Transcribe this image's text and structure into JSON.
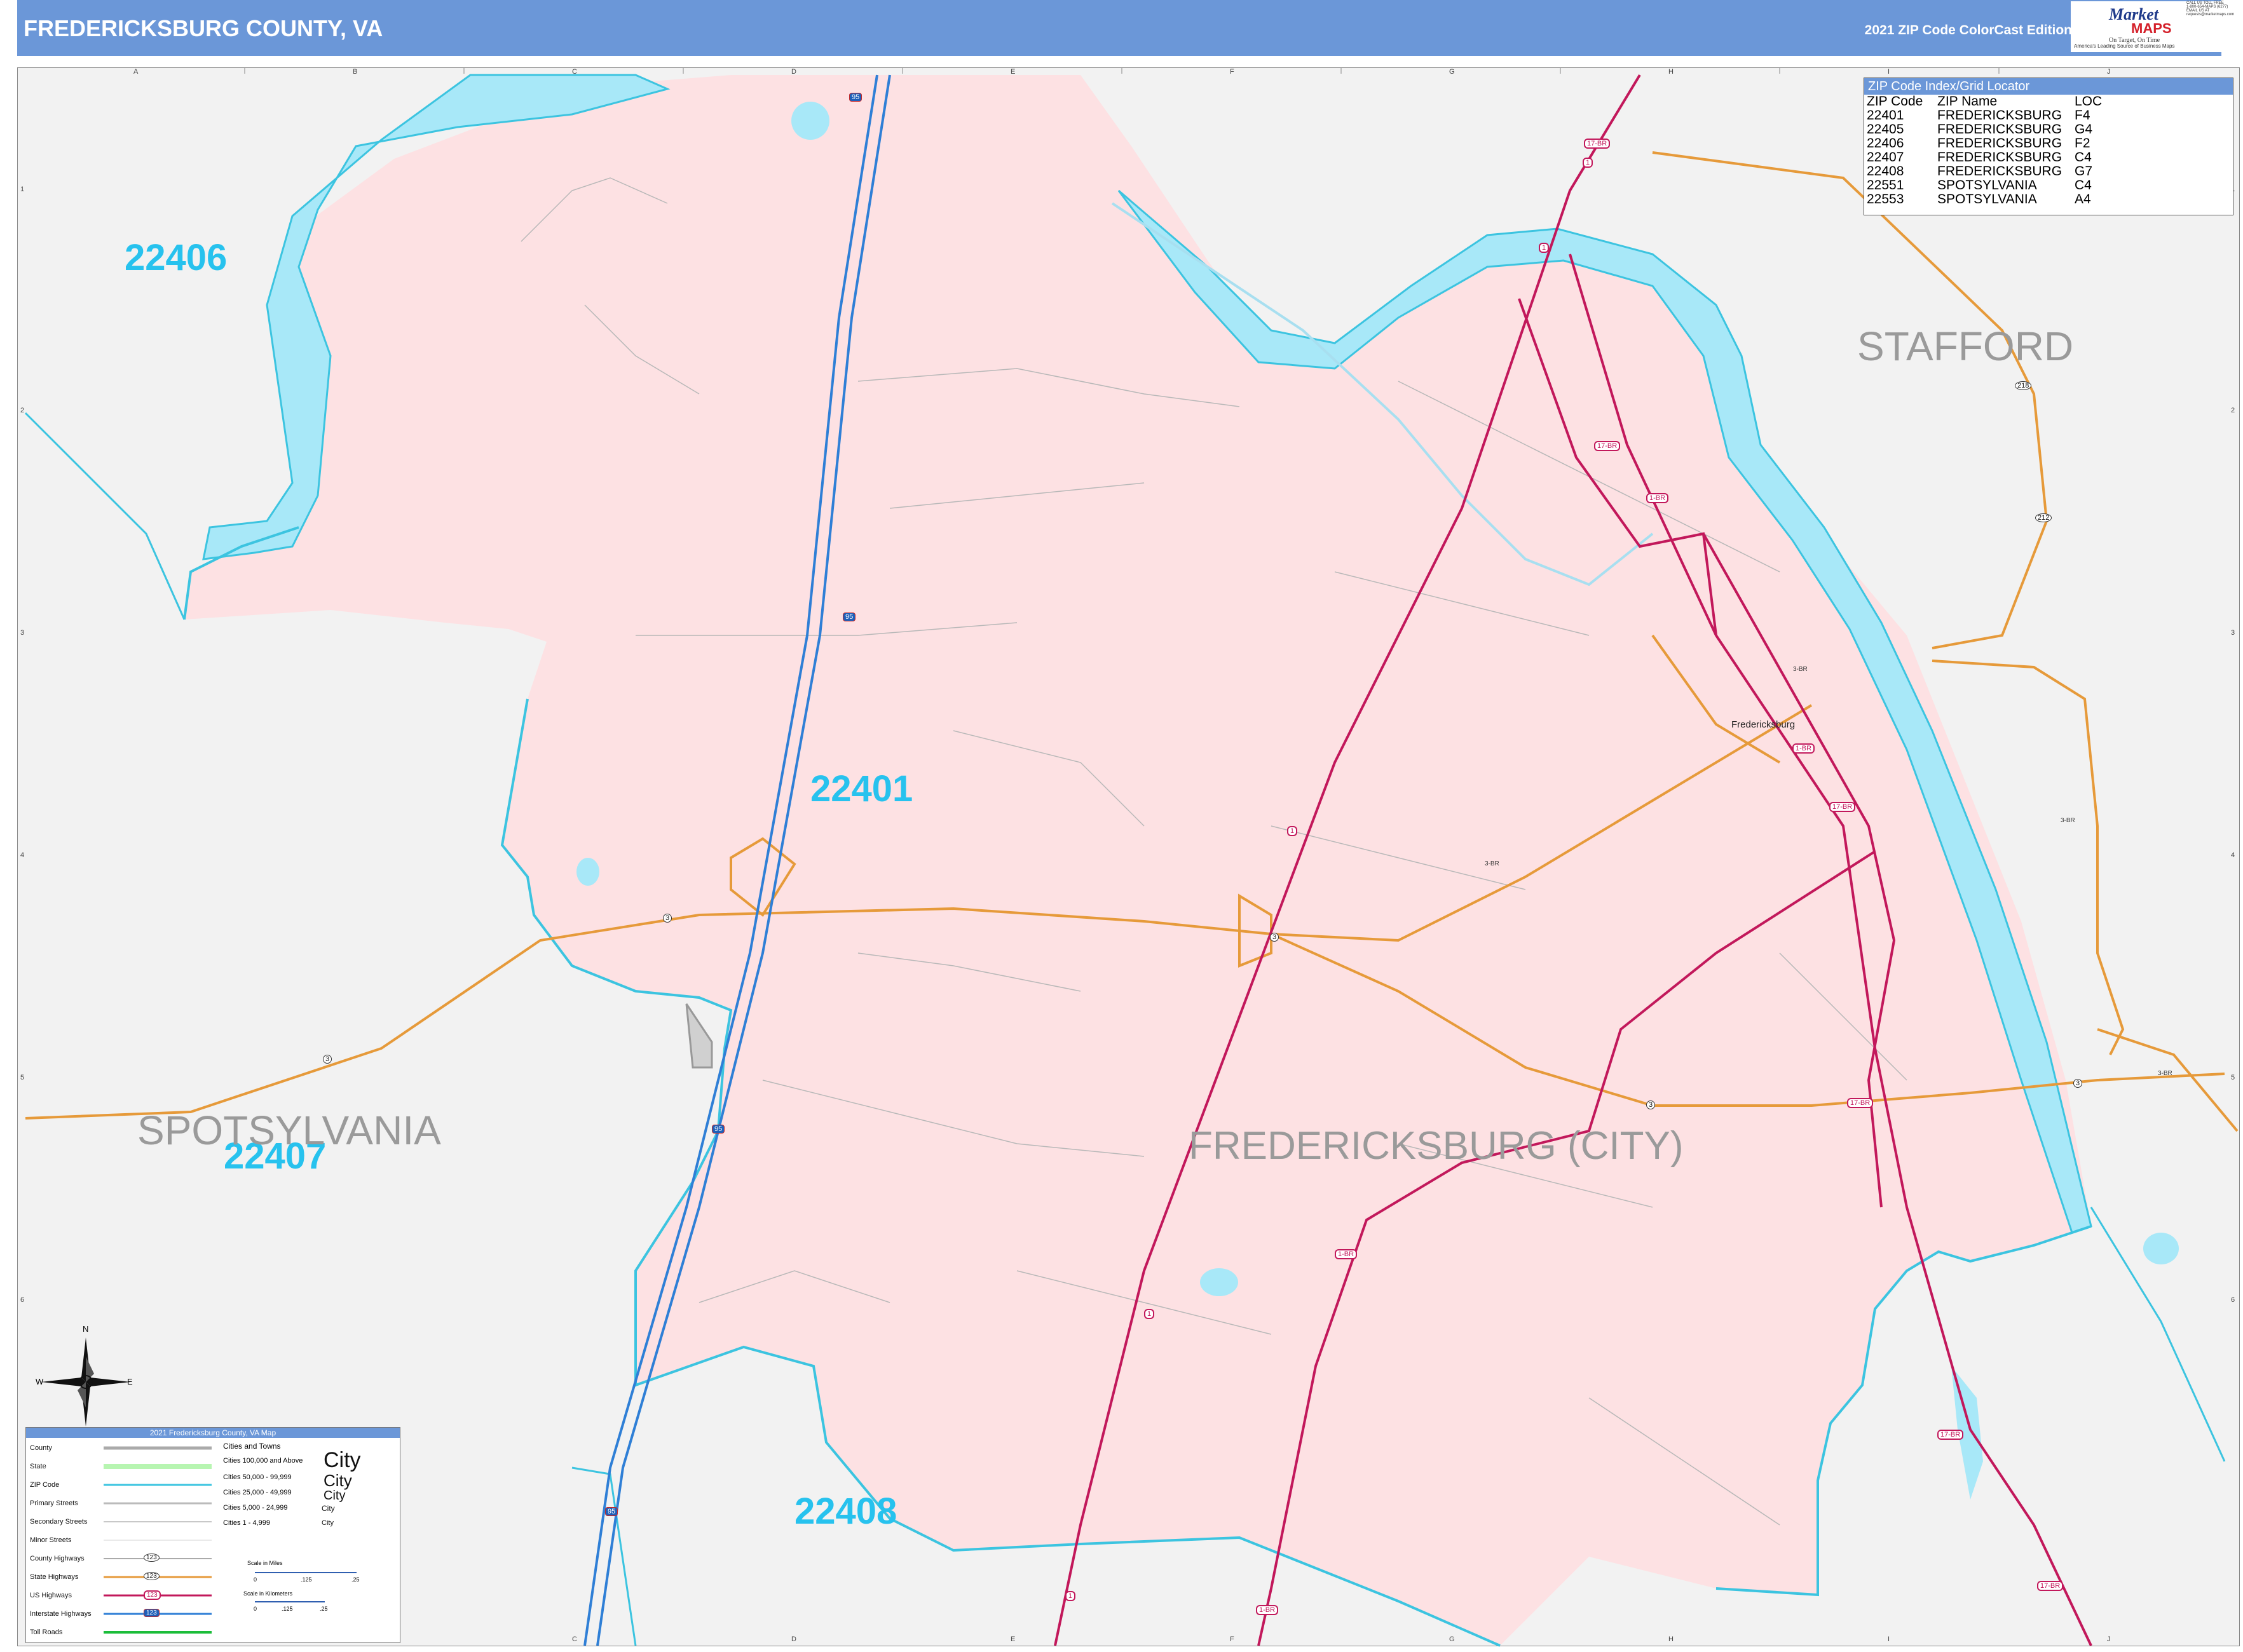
{
  "header": {
    "title": "FREDERICKSBURG COUNTY, VA",
    "edition": "2021 ZIP Code ColorCast Edition"
  },
  "logo": {
    "brand_top": "Market",
    "brand_bottom": "MAPS",
    "tagline": "On Target, On Time",
    "subtitle": "America's Leading Source of Business Maps",
    "contact": [
      "CALL US TOLL FREE",
      "1-800-654-MAPS (6277)",
      "EMAIL US AT",
      "requests@marketmaps.com"
    ]
  },
  "grid": {
    "letters": [
      "A",
      "B",
      "C",
      "D",
      "E",
      "F",
      "G",
      "H",
      "I",
      "J"
    ],
    "numbers": [
      "1",
      "2",
      "3",
      "4",
      "5",
      "6"
    ]
  },
  "zip_labels": [
    "22406",
    "22401",
    "22407",
    "22408"
  ],
  "county_labels": {
    "stafford": "STAFFORD",
    "spotsylvania": "SPOTSYLVANIA",
    "fredericksburg_city": "FREDERICKSBURG (CITY)"
  },
  "town_label": "Fredericksburg",
  "route_shields": {
    "us_17br": "17-BR",
    "us_1": "1",
    "us_1br": "1-BR",
    "state_3": "3",
    "state_3br": "3-BR",
    "state_218": "218",
    "state_212": "212",
    "i_95": "95"
  },
  "zip_index": {
    "title": "ZIP Code Index/Grid Locator",
    "columns": [
      "ZIP Code",
      "ZIP Name",
      "LOC"
    ],
    "rows": [
      [
        "22401",
        "FREDERICKSBURG",
        "F4"
      ],
      [
        "22405",
        "FREDERICKSBURG",
        "G4"
      ],
      [
        "22406",
        "FREDERICKSBURG",
        "F2"
      ],
      [
        "22407",
        "FREDERICKSBURG",
        "C4"
      ],
      [
        "22408",
        "FREDERICKSBURG",
        "G7"
      ],
      [
        "22551",
        "SPOTSYLVANIA",
        "C4"
      ],
      [
        "22553",
        "SPOTSYLVANIA",
        "A4"
      ]
    ]
  },
  "compass": {
    "n": "N",
    "s": "S",
    "e": "E",
    "w": "W"
  },
  "legend": {
    "title": "2021 Fredericksburg County, VA Map",
    "items": [
      "County",
      "State",
      "ZIP Code",
      "Primary Streets",
      "Secondary Streets",
      "Minor Streets",
      "County Highways",
      "State Highways",
      "US Highways",
      "Interstate Highways",
      "Toll Roads"
    ],
    "cities_title": "Cities and Towns",
    "cities": [
      "Cities 100,000 and Above",
      "Cities 50,000 - 99,999",
      "Cities 25,000 - 49,999",
      "Cities 5,000 - 24,999",
      "Cities 1 - 4,999"
    ],
    "city_word": "City",
    "shield_number": "123",
    "scale_miles": "Scale in Miles",
    "scale_km": "Scale in Kilometers",
    "scale_ticks": [
      "0",
      ".125",
      ".25"
    ]
  },
  "colors": {
    "header": "#6b97d8",
    "zip_area": "#fde1e3",
    "water": "#a8e8f8",
    "zip_boundary": "#3cc4e0",
    "zip_text": "#27c2ee",
    "us_highway": "#c2185b",
    "state_highway": "#e69a3a",
    "interstate": "#2f7fd6"
  }
}
